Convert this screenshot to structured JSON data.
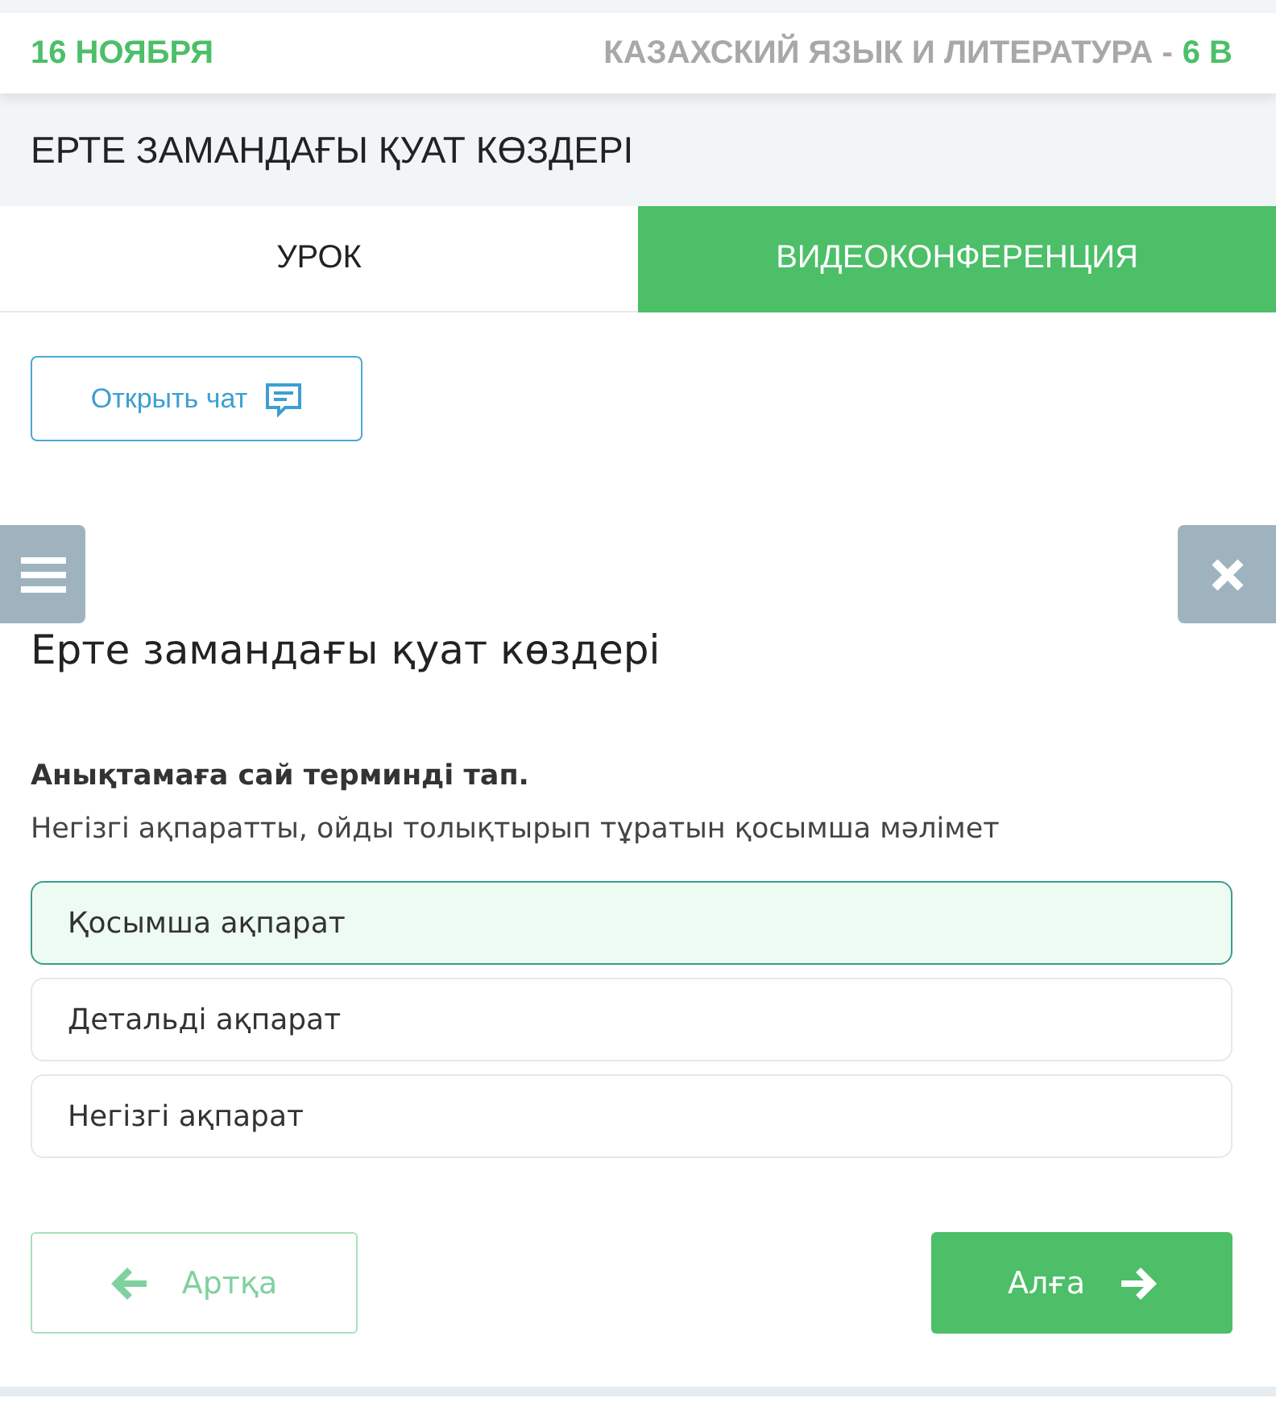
{
  "header": {
    "date": "16 НОЯБРЯ",
    "subject": "КАЗАХСКИЙ ЯЗЫК И ЛИТЕРАТУРА -",
    "class": "6 В"
  },
  "lesson_title": "ЕРТЕ ЗАМАНДАҒЫ ҚУАТ КӨЗДЕРІ",
  "tabs": [
    {
      "label": "УРОК",
      "selected": false
    },
    {
      "label": "ВИДЕОКОНФЕРЕНЦИЯ",
      "selected": true
    }
  ],
  "chat_button": {
    "label": "Открыть чат"
  },
  "task": {
    "title": "Ерте замандағы қуат көздері",
    "question": "Анықтамаға сай терминді тап.",
    "prompt": "Негізгі ақпаратты, ойды толықтырып тұратын қосымша мәлімет",
    "options": [
      {
        "label": "Қосымша ақпарат",
        "selected": true
      },
      {
        "label": "Детальді ақпарат",
        "selected": false
      },
      {
        "label": "Негізгі ақпарат",
        "selected": false
      }
    ]
  },
  "navigation": {
    "back": {
      "label": "Артқа",
      "disabled": true
    },
    "next": {
      "label": "Алға",
      "disabled": false
    }
  }
}
